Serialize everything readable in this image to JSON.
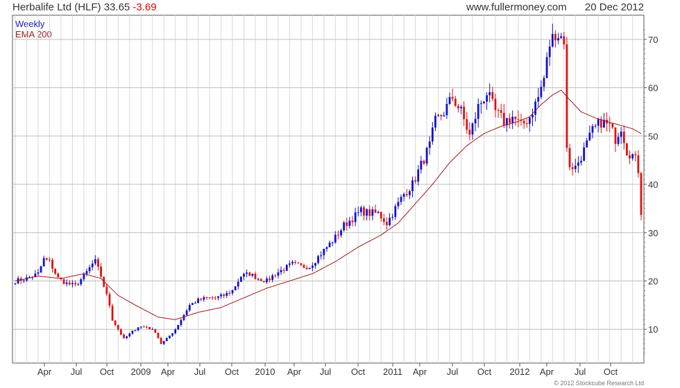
{
  "header": {
    "title": "Herbalife Ltd (HLF) 33.65",
    "change": "-3.69",
    "site": "www.fullermoney.com",
    "date": "20 Dec 2012"
  },
  "legend": {
    "weekly": "Weekly",
    "ema": "EMA 200"
  },
  "footer": {
    "copyright": "© 2012 Stockcube Research Ltd"
  },
  "colors": {
    "up": "#1010d0",
    "down": "#e01010",
    "ema": "#a01818",
    "grid": "#d8d8d8",
    "frame": "#555555"
  },
  "chart_data": {
    "type": "candlestick",
    "ylim": [
      3,
      75
    ],
    "y_ticks": [
      10,
      20,
      30,
      40,
      50,
      60,
      70
    ],
    "x_labels": [
      "Apr",
      "Jul",
      "Oct",
      "2009",
      "Apr",
      "Jul",
      "Oct",
      "2010",
      "Apr",
      "Jul",
      "Oct",
      "2011",
      "Apr",
      "Jul",
      "Oct",
      "2012",
      "Apr",
      "Jul",
      "Oct"
    ],
    "grid": true,
    "weekly_close_anchors": [
      [
        0,
        20
      ],
      [
        4,
        20.5
      ],
      [
        8,
        21.5
      ],
      [
        10,
        24.5
      ],
      [
        12,
        24
      ],
      [
        15,
        20.5
      ],
      [
        18,
        19.5
      ],
      [
        21,
        19
      ],
      [
        24,
        21
      ],
      [
        27,
        23.5
      ],
      [
        28,
        24
      ],
      [
        30,
        21
      ],
      [
        31,
        19
      ],
      [
        33,
        15
      ],
      [
        34,
        12
      ],
      [
        36,
        10
      ],
      [
        38,
        8
      ],
      [
        40,
        9
      ],
      [
        43,
        10.5
      ],
      [
        46,
        10.5
      ],
      [
        49,
        9.5
      ],
      [
        51,
        7
      ],
      [
        53,
        8
      ],
      [
        56,
        10
      ],
      [
        58,
        12
      ],
      [
        61,
        15
      ],
      [
        64,
        16
      ],
      [
        67,
        16.5
      ],
      [
        70,
        16.5
      ],
      [
        73,
        17
      ],
      [
        76,
        18
      ],
      [
        79,
        21
      ],
      [
        82,
        21.5
      ],
      [
        85,
        20.5
      ],
      [
        88,
        20
      ],
      [
        91,
        21.5
      ],
      [
        94,
        22.5
      ],
      [
        97,
        23.5
      ],
      [
        100,
        23
      ],
      [
        103,
        23
      ],
      [
        106,
        25
      ],
      [
        109,
        27
      ],
      [
        112,
        29
      ],
      [
        115,
        31.5
      ],
      [
        118,
        33
      ],
      [
        121,
        34.5
      ],
      [
        124,
        34
      ],
      [
        127,
        34
      ],
      [
        130,
        32
      ],
      [
        133,
        35
      ],
      [
        136,
        38
      ],
      [
        139,
        40
      ],
      [
        142,
        44
      ],
      [
        145,
        48
      ],
      [
        147,
        53
      ],
      [
        150,
        55
      ],
      [
        153,
        58
      ],
      [
        156,
        55
      ],
      [
        159,
        50
      ],
      [
        162,
        56
      ],
      [
        165,
        59
      ],
      [
        168,
        55
      ],
      [
        171,
        53
      ],
      [
        174,
        54
      ],
      [
        177,
        52
      ],
      [
        180,
        54
      ],
      [
        183,
        58
      ],
      [
        185,
        62
      ],
      [
        187,
        69
      ],
      [
        189,
        71.5
      ],
      [
        192,
        70
      ],
      [
        193,
        47
      ],
      [
        194,
        44
      ],
      [
        196,
        43.5
      ],
      [
        199,
        47
      ],
      [
        202,
        51
      ],
      [
        205,
        53
      ],
      [
        208,
        52
      ],
      [
        210,
        49.5
      ],
      [
        212,
        52
      ],
      [
        214,
        47
      ],
      [
        216,
        46
      ],
      [
        217,
        45
      ],
      [
        218,
        43
      ],
      [
        219,
        33.65
      ]
    ],
    "ema_anchors": [
      [
        0,
        20
      ],
      [
        8,
        21
      ],
      [
        16,
        20.5
      ],
      [
        24,
        21.5
      ],
      [
        30,
        20.5
      ],
      [
        36,
        17
      ],
      [
        42,
        15
      ],
      [
        50,
        12.5
      ],
      [
        56,
        12
      ],
      [
        64,
        13.5
      ],
      [
        72,
        14.5
      ],
      [
        80,
        16.5
      ],
      [
        88,
        18.5
      ],
      [
        96,
        20
      ],
      [
        104,
        21.5
      ],
      [
        112,
        24
      ],
      [
        120,
        27
      ],
      [
        128,
        29.5
      ],
      [
        134,
        32
      ],
      [
        140,
        36
      ],
      [
        146,
        40
      ],
      [
        152,
        44.5
      ],
      [
        158,
        48
      ],
      [
        164,
        50.5
      ],
      [
        170,
        52
      ],
      [
        176,
        53
      ],
      [
        180,
        54
      ],
      [
        184,
        56.5
      ],
      [
        188,
        58.5
      ],
      [
        191,
        59.5
      ],
      [
        194,
        57.5
      ],
      [
        198,
        55
      ],
      [
        204,
        53.5
      ],
      [
        210,
        52.5
      ],
      [
        216,
        51.5
      ],
      [
        219,
        50.5
      ]
    ],
    "total_weeks": 220
  }
}
